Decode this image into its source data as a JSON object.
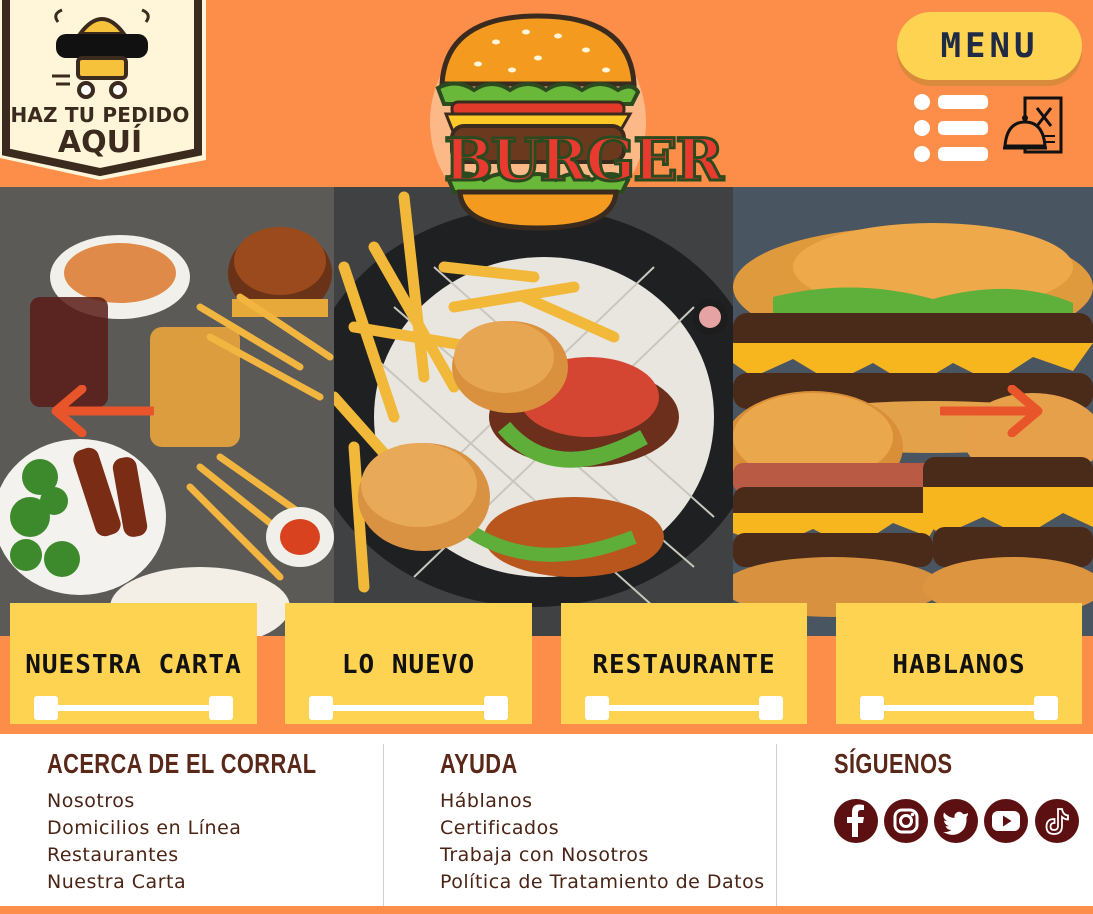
{
  "header": {
    "order_line1": "HAZ TU PEDIDO",
    "order_line2": "AQUÍ",
    "logo_text": "BURGER",
    "menu_label": "MENU"
  },
  "carousel": {
    "slides": [
      "burger-combo-table-photo",
      "burger-fries-basket-photo",
      "stacked-cheeseburgers-photo"
    ]
  },
  "cards": [
    {
      "title": "NUESTRA CARTA"
    },
    {
      "title": "LO NUEVO"
    },
    {
      "title": "RESTAURANTE"
    },
    {
      "title": "HABLANOS"
    }
  ],
  "footer": {
    "about": {
      "heading": "ACERCA DE EL CORRAL",
      "links": [
        "Nosotros",
        "Domicilios en Línea",
        "Restaurantes",
        "Nuestra Carta"
      ]
    },
    "help": {
      "heading": "AYUDA",
      "links": [
        "Háblanos",
        "Certificados",
        "Trabaja con Nosotros",
        "Política de Tratamiento de Datos"
      ]
    },
    "follow": {
      "heading": "SÍGUENOS",
      "socials": [
        "facebook-icon",
        "instagram-icon",
        "twitter-icon",
        "youtube-icon",
        "tiktok-icon"
      ]
    }
  },
  "colors": {
    "orange": "#fc8e4a",
    "yellow": "#fed352",
    "dark_brown": "#5a2818",
    "social_red": "#5c1011",
    "arrow": "#e8552a"
  }
}
